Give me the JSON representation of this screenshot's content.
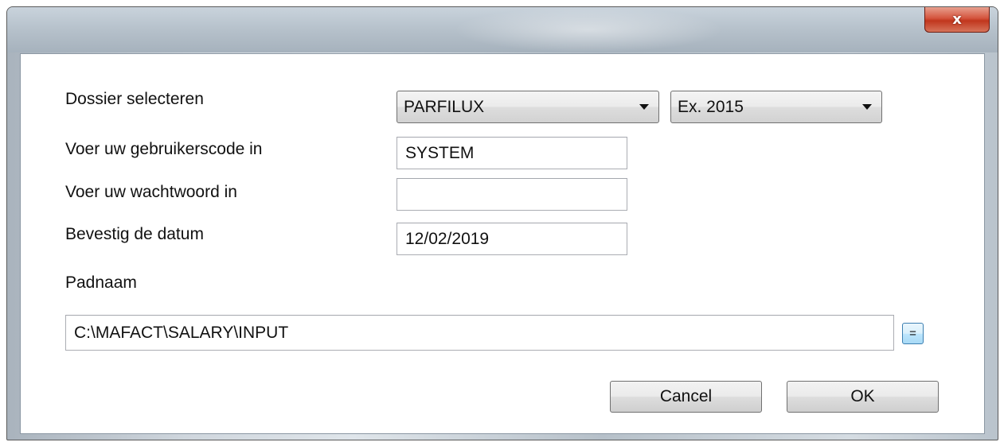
{
  "window": {
    "close_label": "x"
  },
  "form": {
    "dossier_label": "Dossier selecteren",
    "dossier_value": "PARFILUX",
    "exercise_value": "Ex. 2015",
    "user_label": "Voer uw gebruikerscode in",
    "user_value": "SYSTEM",
    "password_label": "Voer uw wachtwoord in",
    "password_value": "",
    "date_label": "Bevestig de datum",
    "date_value": "12/02/2019",
    "path_label": "Padnaam",
    "path_value": "C:\\MAFACT\\SALARY\\INPUT",
    "browse_label": "="
  },
  "buttons": {
    "cancel_label": "Cancel",
    "ok_label": "OK"
  },
  "colors": {
    "close_button": "#c7432b",
    "window_frame": "#b4bfc9",
    "browse_button_border": "#3c7fb1"
  }
}
